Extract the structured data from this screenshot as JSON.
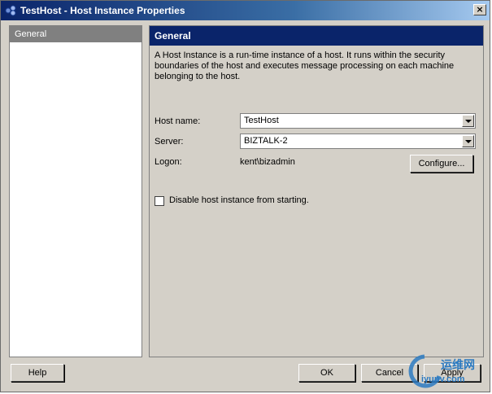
{
  "window": {
    "title": "TestHost - Host Instance Properties",
    "close_label": "×"
  },
  "nav": {
    "items": [
      {
        "label": "General",
        "selected": true
      }
    ]
  },
  "section": {
    "title": "General",
    "description": "A Host Instance is a run-time instance of a host. It runs within the security boundaries of the host and executes message processing on each machine belonging to the host."
  },
  "form": {
    "host_name_label": "Host name:",
    "host_name_value": "TestHost",
    "server_label": "Server:",
    "server_value": "BIZTALK-2",
    "logon_label": "Logon:",
    "logon_value": "kent\\bizadmin",
    "configure_label": "Configure...",
    "disable_label": "Disable host instance from starting.",
    "disable_checked": false
  },
  "buttons": {
    "help": "Help",
    "ok": "OK",
    "cancel": "Cancel",
    "apply": "Apply"
  },
  "watermark": {
    "line1": "运维网",
    "line2": "iyunv.com"
  },
  "colors": {
    "title_bar": "#0a246a",
    "section_header": "#0a246a",
    "dialog_bg": "#d4d0c8"
  }
}
